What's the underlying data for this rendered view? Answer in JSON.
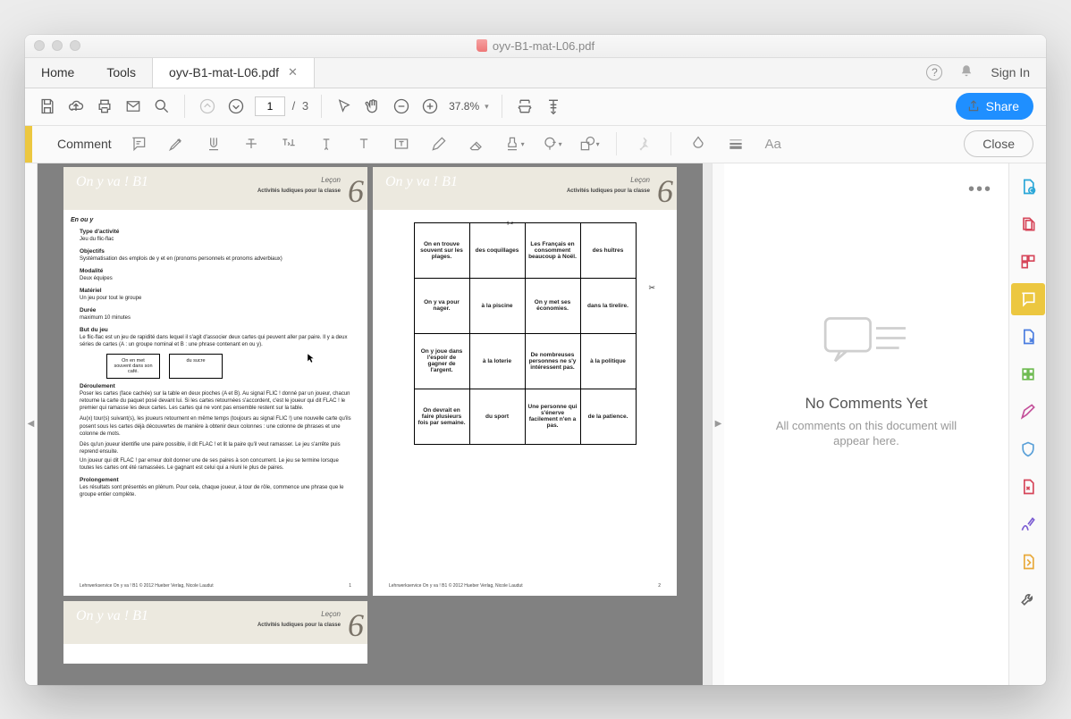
{
  "window": {
    "title": "oyv-B1-mat-L06.pdf"
  },
  "tabs": {
    "home": "Home",
    "tools": "Tools",
    "doc": "oyv-B1-mat-L06.pdf",
    "signin": "Sign In"
  },
  "toolbar": {
    "page_current": "1",
    "page_sep": "/",
    "page_total": "3",
    "zoom": "37.8%",
    "share": "Share"
  },
  "commentbar": {
    "title": "Comment",
    "close": "Close"
  },
  "comments": {
    "heading": "No Comments Yet",
    "text": "All comments on this document will appear here."
  },
  "doc": {
    "series": "On y va ! B1",
    "lesson": "Leçon",
    "lessonnum": "6",
    "subtitle": "Activités ludiques pour la classe",
    "footer": "Lehrwerkservice On y va ! B1 © 2012 Hueber Verlag, Nicole Laudut",
    "p1": {
      "enouy": "En ou y",
      "s1": {
        "h": "Type d'activité",
        "t": "Jeu du flic-flac"
      },
      "s2": {
        "h": "Objectifs",
        "t": "Systématisation des emplois de y et en (pronoms personnels et pronoms adverbiaux)"
      },
      "s3": {
        "h": "Modalité",
        "t": "Deux équipes"
      },
      "s4": {
        "h": "Matériel",
        "t": "Un jeu pour tout le groupe"
      },
      "s5": {
        "h": "Durée",
        "t": "maximum 10 minutes"
      },
      "s6": {
        "h": "But du jeu",
        "t": "Le flic-flac est un jeu de rapidité dans lequel il s'agit d'associer deux cartes qui peuvent aller par paire. Il y a deux séries de cartes (A : un groupe nominal et B : une phrase contenant en ou y)."
      },
      "card1": "On en met souvent dans son café.",
      "card2": "du sucre",
      "s7h": "Déroulement",
      "s7t1": "Poser les cartes (face cachée) sur la table en deux pioches (A et B). Au signal FLIC ! donné par un joueur, chacun retourne la carte du paquet posé devant lui. Si les cartes retournées s'accordent, c'est le joueur qui dit FLAC ! le premier qui ramasse les deux cartes. Les cartes qui ne vont pas ensemble restent sur la table.",
      "s7t2": "Au(x) tour(s) suivant(s), les joueurs retournent en même temps (toujours au signal FLIC !) une nouvelle carte qu'ils posent sous les cartes déjà découvertes de manière à obtenir deux colonnes : une colonne de phrases et une colonne de mots.",
      "s7t3": "Dès qu'un joueur identifie une paire possible, il dit FLAC ! et lit la paire qu'il veut ramasser. Le jeu s'arrête puis reprend ensuite.",
      "s7t4": "Un joueur qui dit FLAC ! par erreur doit donner une de ses paires à son concurrent. Le jeu se termine lorsque toutes les cartes ont été ramassées. Le gagnant est celui qui a réuni le plus de paires.",
      "s8": {
        "h": "Prolongement",
        "t": "Les résultats sont présentés en plénum. Pour cela, chaque joueur, à tour de rôle, commence une phrase que le groupe entier complète."
      },
      "pagenum": "1"
    },
    "p2": {
      "pagenum": "2",
      "grid": [
        [
          "On en trouve souvent sur les plages.",
          "des coquillages",
          "Les Français en consomment beaucoup à Noël.",
          "des huîtres"
        ],
        [
          "On y va pour nager.",
          "à la piscine",
          "On y met ses économies.",
          "dans la tirelire."
        ],
        [
          "On y joue dans l'espoir de gagner de l'argent.",
          "à la loterie",
          "De nombreuses personnes ne s'y intéressent pas.",
          "à la politique"
        ],
        [
          "On devrait en faire plusieurs fois par semaine.",
          "du sport",
          "Une personne qui s'énerve facilement n'en a pas.",
          "de la patience."
        ]
      ]
    }
  }
}
